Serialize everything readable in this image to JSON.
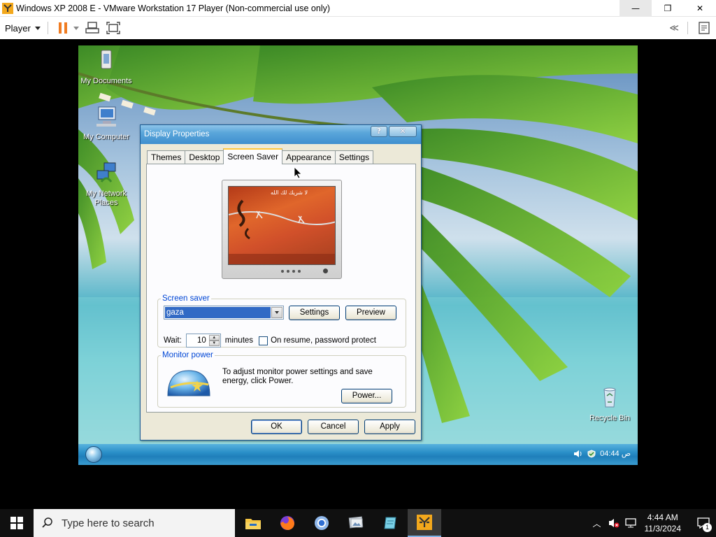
{
  "vmware": {
    "window_title": "Windows XP 2008 E - VMware Workstation 17 Player (Non-commercial use only)",
    "player_menu": "Player",
    "min_glyph": "—",
    "max_glyph": "❐",
    "close_glyph": "✕",
    "unity_glyph": "≪"
  },
  "guest": {
    "desktop_icons": [
      {
        "label": "My Documents",
        "icon": "documents-icon"
      },
      {
        "label": "My Computer",
        "icon": "computer-icon"
      },
      {
        "label": "My Network Places",
        "icon": "network-icon"
      },
      {
        "label": "Recycle Bin",
        "icon": "recycle-bin-icon"
      }
    ],
    "taskbar": {
      "clock": "ص 04:44"
    }
  },
  "dialog": {
    "title": "Display Properties",
    "help_glyph": "?",
    "close_glyph": "✕",
    "tabs": [
      {
        "label": "Themes",
        "active": false
      },
      {
        "label": "Desktop",
        "active": false
      },
      {
        "label": "Screen Saver",
        "active": true
      },
      {
        "label": "Appearance",
        "active": false
      },
      {
        "label": "Settings",
        "active": false
      }
    ],
    "preview_caption": "لا شريك لك الله",
    "screen_saver": {
      "legend": "Screen saver",
      "selected": "gaza",
      "settings_button": "Settings",
      "preview_button": "Preview",
      "wait_label": "Wait:",
      "wait_value": "10",
      "minutes_label": "minutes",
      "password_checkbox_label": "On resume, password protect",
      "password_checked": false
    },
    "monitor_power": {
      "legend": "Monitor power",
      "description": "To adjust monitor power settings and save energy, click Power.",
      "power_button": "Power..."
    },
    "buttons": {
      "ok": "OK",
      "cancel": "Cancel",
      "apply": "Apply"
    }
  },
  "host": {
    "search_placeholder": "Type here to search",
    "apps": [
      "file-explorer-icon",
      "firefox-icon",
      "chrome-icon",
      "photos-icon",
      "notepad-icon",
      "vmware-icon"
    ],
    "clock_time": "4:44 AM",
    "clock_date": "11/3/2024",
    "notification_count": "1"
  },
  "colors": {
    "xp_title_blue": "#3f8fcf",
    "vmware_orange": "#f07c22",
    "selection_blue": "#316ac5",
    "group_legend_blue": "#0046d5"
  }
}
